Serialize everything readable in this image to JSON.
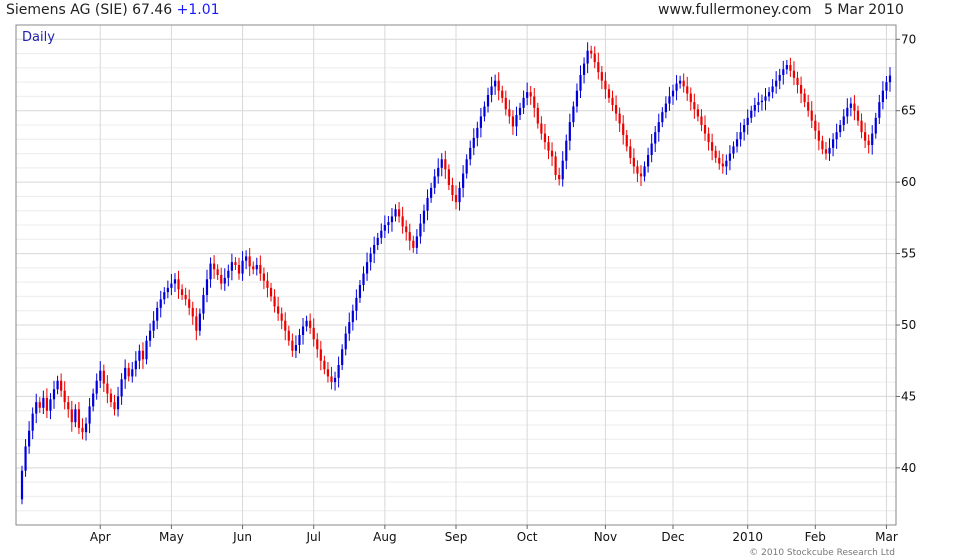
{
  "header": {
    "title": "Siemens AG (SIE) 67.46",
    "change": "+1.01",
    "site": "www.fullermoney.com",
    "date": "5 Mar 2010"
  },
  "chart_label": "Daily",
  "copyright": "© 2010 Stockcube Research Ltd",
  "colors": {
    "up": "#0000dd",
    "down": "#ee0000",
    "grid": "#d8d8d8",
    "gridMinor": "#ececec"
  },
  "chart_data": {
    "type": "candlestick",
    "ylim": [
      36,
      71
    ],
    "y_ticks": [
      40,
      45,
      50,
      55,
      60,
      65,
      70
    ],
    "x_tick_labels": [
      "Apr",
      "May",
      "Jun",
      "Jul",
      "Aug",
      "Sep",
      "Oct",
      "Nov",
      "Dec",
      "2010",
      "Feb",
      "Mar"
    ],
    "x_tick_index": [
      22,
      42,
      62,
      82,
      102,
      122,
      142,
      164,
      183,
      204,
      223,
      243
    ],
    "closes": [
      39.8,
      41.5,
      42.6,
      43.8,
      44.6,
      44.2,
      44.9,
      44.0,
      44.8,
      45.5,
      46.1,
      45.4,
      44.6,
      44.1,
      43.2,
      44.1,
      42.8,
      42.5,
      43.1,
      44.3,
      45.2,
      46.1,
      46.8,
      45.9,
      45.2,
      44.6,
      44.1,
      45.0,
      46.2,
      47.0,
      46.4,
      46.9,
      47.5,
      48.2,
      47.6,
      48.9,
      49.6,
      50.3,
      51.2,
      51.8,
      52.3,
      52.6,
      52.9,
      53.2,
      52.5,
      52.1,
      51.8,
      51.2,
      50.6,
      49.6,
      50.8,
      52.1,
      53.2,
      54.3,
      53.9,
      53.5,
      52.9,
      53.3,
      53.8,
      54.4,
      54.2,
      53.6,
      54.5,
      54.8,
      54.1,
      53.9,
      54.2,
      53.6,
      53.1,
      52.6,
      52.0,
      51.3,
      50.8,
      50.3,
      49.6,
      48.9,
      48.2,
      48.6,
      49.3,
      49.9,
      50.3,
      49.8,
      49.0,
      48.3,
      47.5,
      46.9,
      46.4,
      46.0,
      46.3,
      47.2,
      48.3,
      49.4,
      50.2,
      51.0,
      51.9,
      52.8,
      53.6,
      54.4,
      55.0,
      55.6,
      56.1,
      56.6,
      57.0,
      57.2,
      57.6,
      58.1,
      57.6,
      56.9,
      56.5,
      55.9,
      55.4,
      56.2,
      57.1,
      58.0,
      58.9,
      59.6,
      60.4,
      61.0,
      61.6,
      60.9,
      59.8,
      59.1,
      58.6,
      59.6,
      60.6,
      61.6,
      62.4,
      63.1,
      63.8,
      64.6,
      65.3,
      66.1,
      66.7,
      67.1,
      66.4,
      65.9,
      65.1,
      64.6,
      63.9,
      64.7,
      65.2,
      65.9,
      66.3,
      66.0,
      65.2,
      64.1,
      63.4,
      62.8,
      62.2,
      61.8,
      60.5,
      60.2,
      61.5,
      62.9,
      64.2,
      65.3,
      66.4,
      67.5,
      68.3,
      69.2,
      69.0,
      68.4,
      67.7,
      67.1,
      66.5,
      65.9,
      65.4,
      64.8,
      64.1,
      63.3,
      62.5,
      61.7,
      61.1,
      60.6,
      60.4,
      61.1,
      61.9,
      62.7,
      63.5,
      64.2,
      64.9,
      65.5,
      66.0,
      66.4,
      66.9,
      67.1,
      66.7,
      66.2,
      65.6,
      65.1,
      64.6,
      64.0,
      63.4,
      62.8,
      62.2,
      61.7,
      61.3,
      61.1,
      61.5,
      62.0,
      62.5,
      63.0,
      63.5,
      64.0,
      64.5,
      65.0,
      65.4,
      65.6,
      65.7,
      66.0,
      66.3,
      66.7,
      67.1,
      67.5,
      67.9,
      68.2,
      67.8,
      67.3,
      66.8,
      66.2,
      65.6,
      65.0,
      64.3,
      63.6,
      62.9,
      62.3,
      62.0,
      62.4,
      63.0,
      63.5,
      64.0,
      64.6,
      65.2,
      65.5,
      65.0,
      64.3,
      63.5,
      62.9,
      62.6,
      63.4,
      64.5,
      65.6,
      66.4,
      67.0,
      67.46
    ]
  }
}
